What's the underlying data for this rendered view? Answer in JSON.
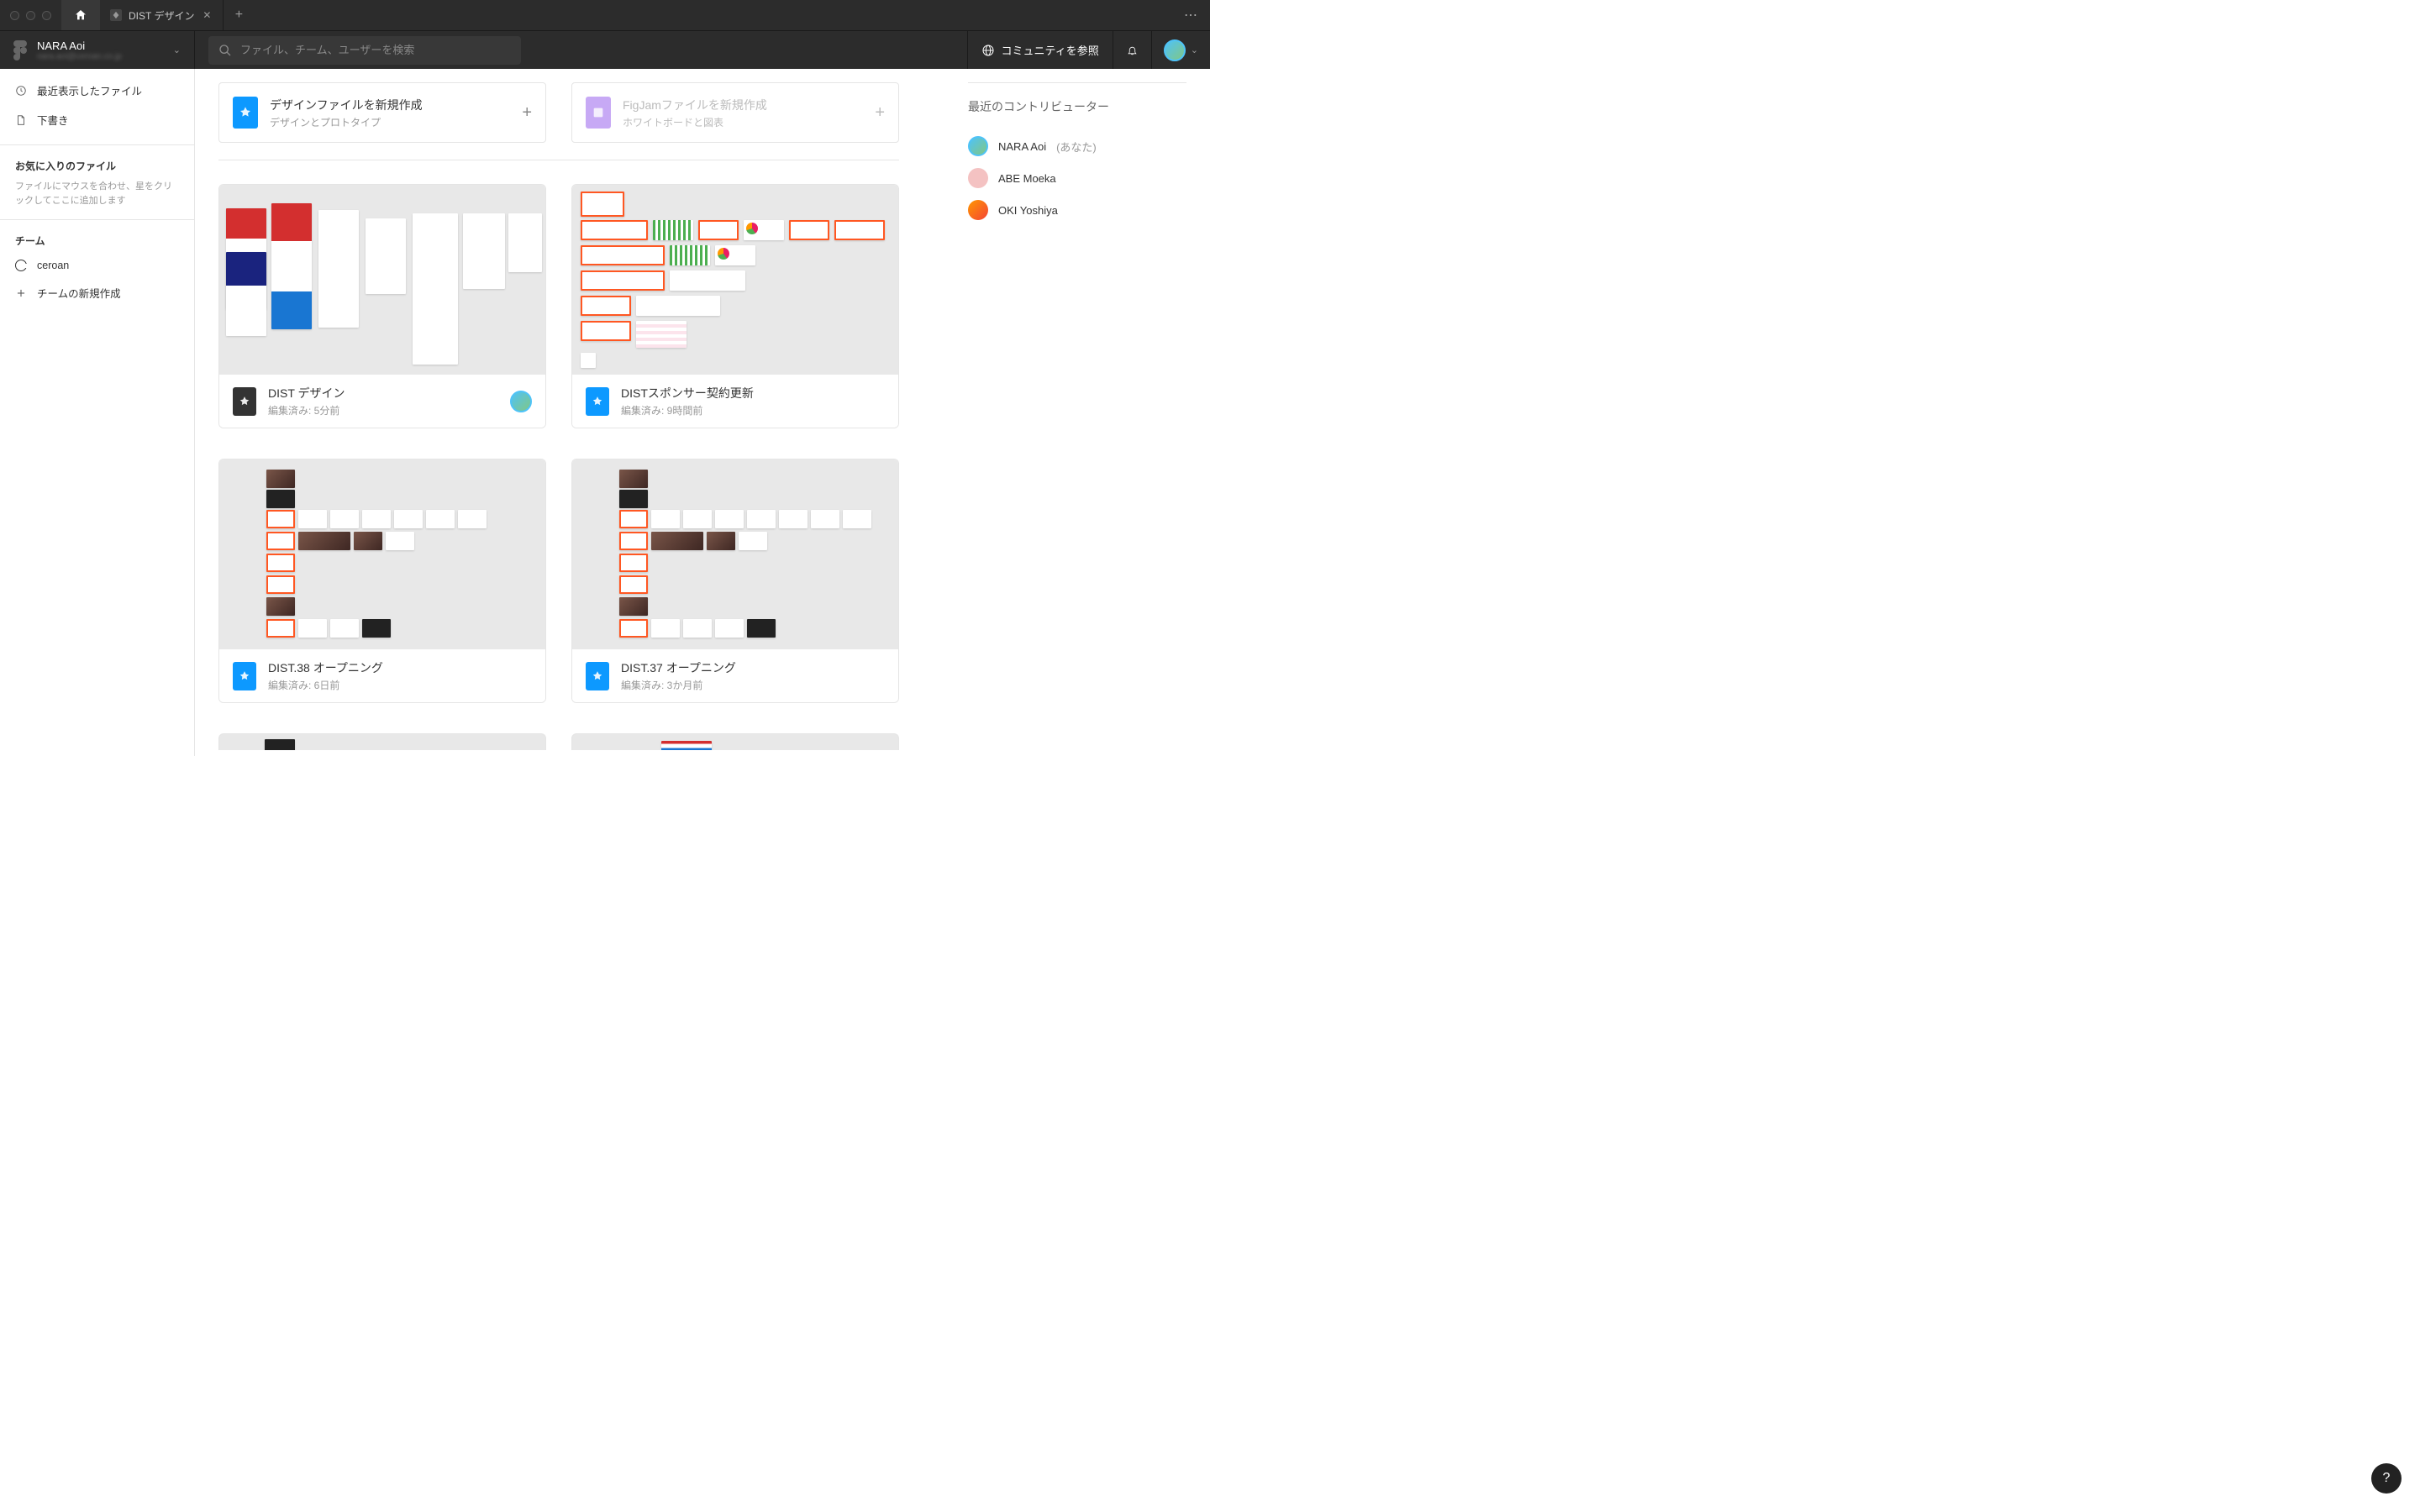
{
  "tabs": {
    "doc_title": "DIST デザイン"
  },
  "user": {
    "name": "NARA Aoi",
    "email": "nara.aoi@ceroan.co.jp"
  },
  "search": {
    "placeholder": "ファイル、チーム、ユーザーを検索"
  },
  "toolbar": {
    "community": "コミュニティを参照"
  },
  "sidebar": {
    "recent": "最近表示したファイル",
    "drafts": "下書き",
    "fav_heading": "お気に入りのファイル",
    "fav_help": "ファイルにマウスを合わせ、星をクリックしてここに追加します",
    "team_heading": "チーム",
    "team_name": "ceroan",
    "create_team": "チームの新規作成"
  },
  "create": {
    "design_title": "デザインファイルを新規作成",
    "design_sub": "デザインとプロトタイプ",
    "figjam_title": "FigJamファイルを新規作成",
    "figjam_sub": "ホワイトボードと図表"
  },
  "contributors": {
    "heading": "最近のコントリビューター",
    "you_suffix": "(あなた)",
    "list": [
      {
        "name": "NARA Aoi",
        "you": true
      },
      {
        "name": "ABE Moeka",
        "you": false
      },
      {
        "name": "OKI Yoshiya",
        "you": false
      }
    ]
  },
  "files": [
    {
      "name": "DIST デザイン",
      "edited": "編集済み: 5分前",
      "icon": "dark",
      "has_avatar": true
    },
    {
      "name": "DISTスポンサー契約更新",
      "edited": "編集済み: 9時間前",
      "icon": "blue",
      "has_avatar": false
    },
    {
      "name": "DIST.38 オープニング",
      "edited": "編集済み: 6日前",
      "icon": "blue",
      "has_avatar": false
    },
    {
      "name": "DIST.37 オープニング",
      "edited": "編集済み: 3か月前",
      "icon": "blue",
      "has_avatar": false
    }
  ],
  "help_glyph": "?"
}
